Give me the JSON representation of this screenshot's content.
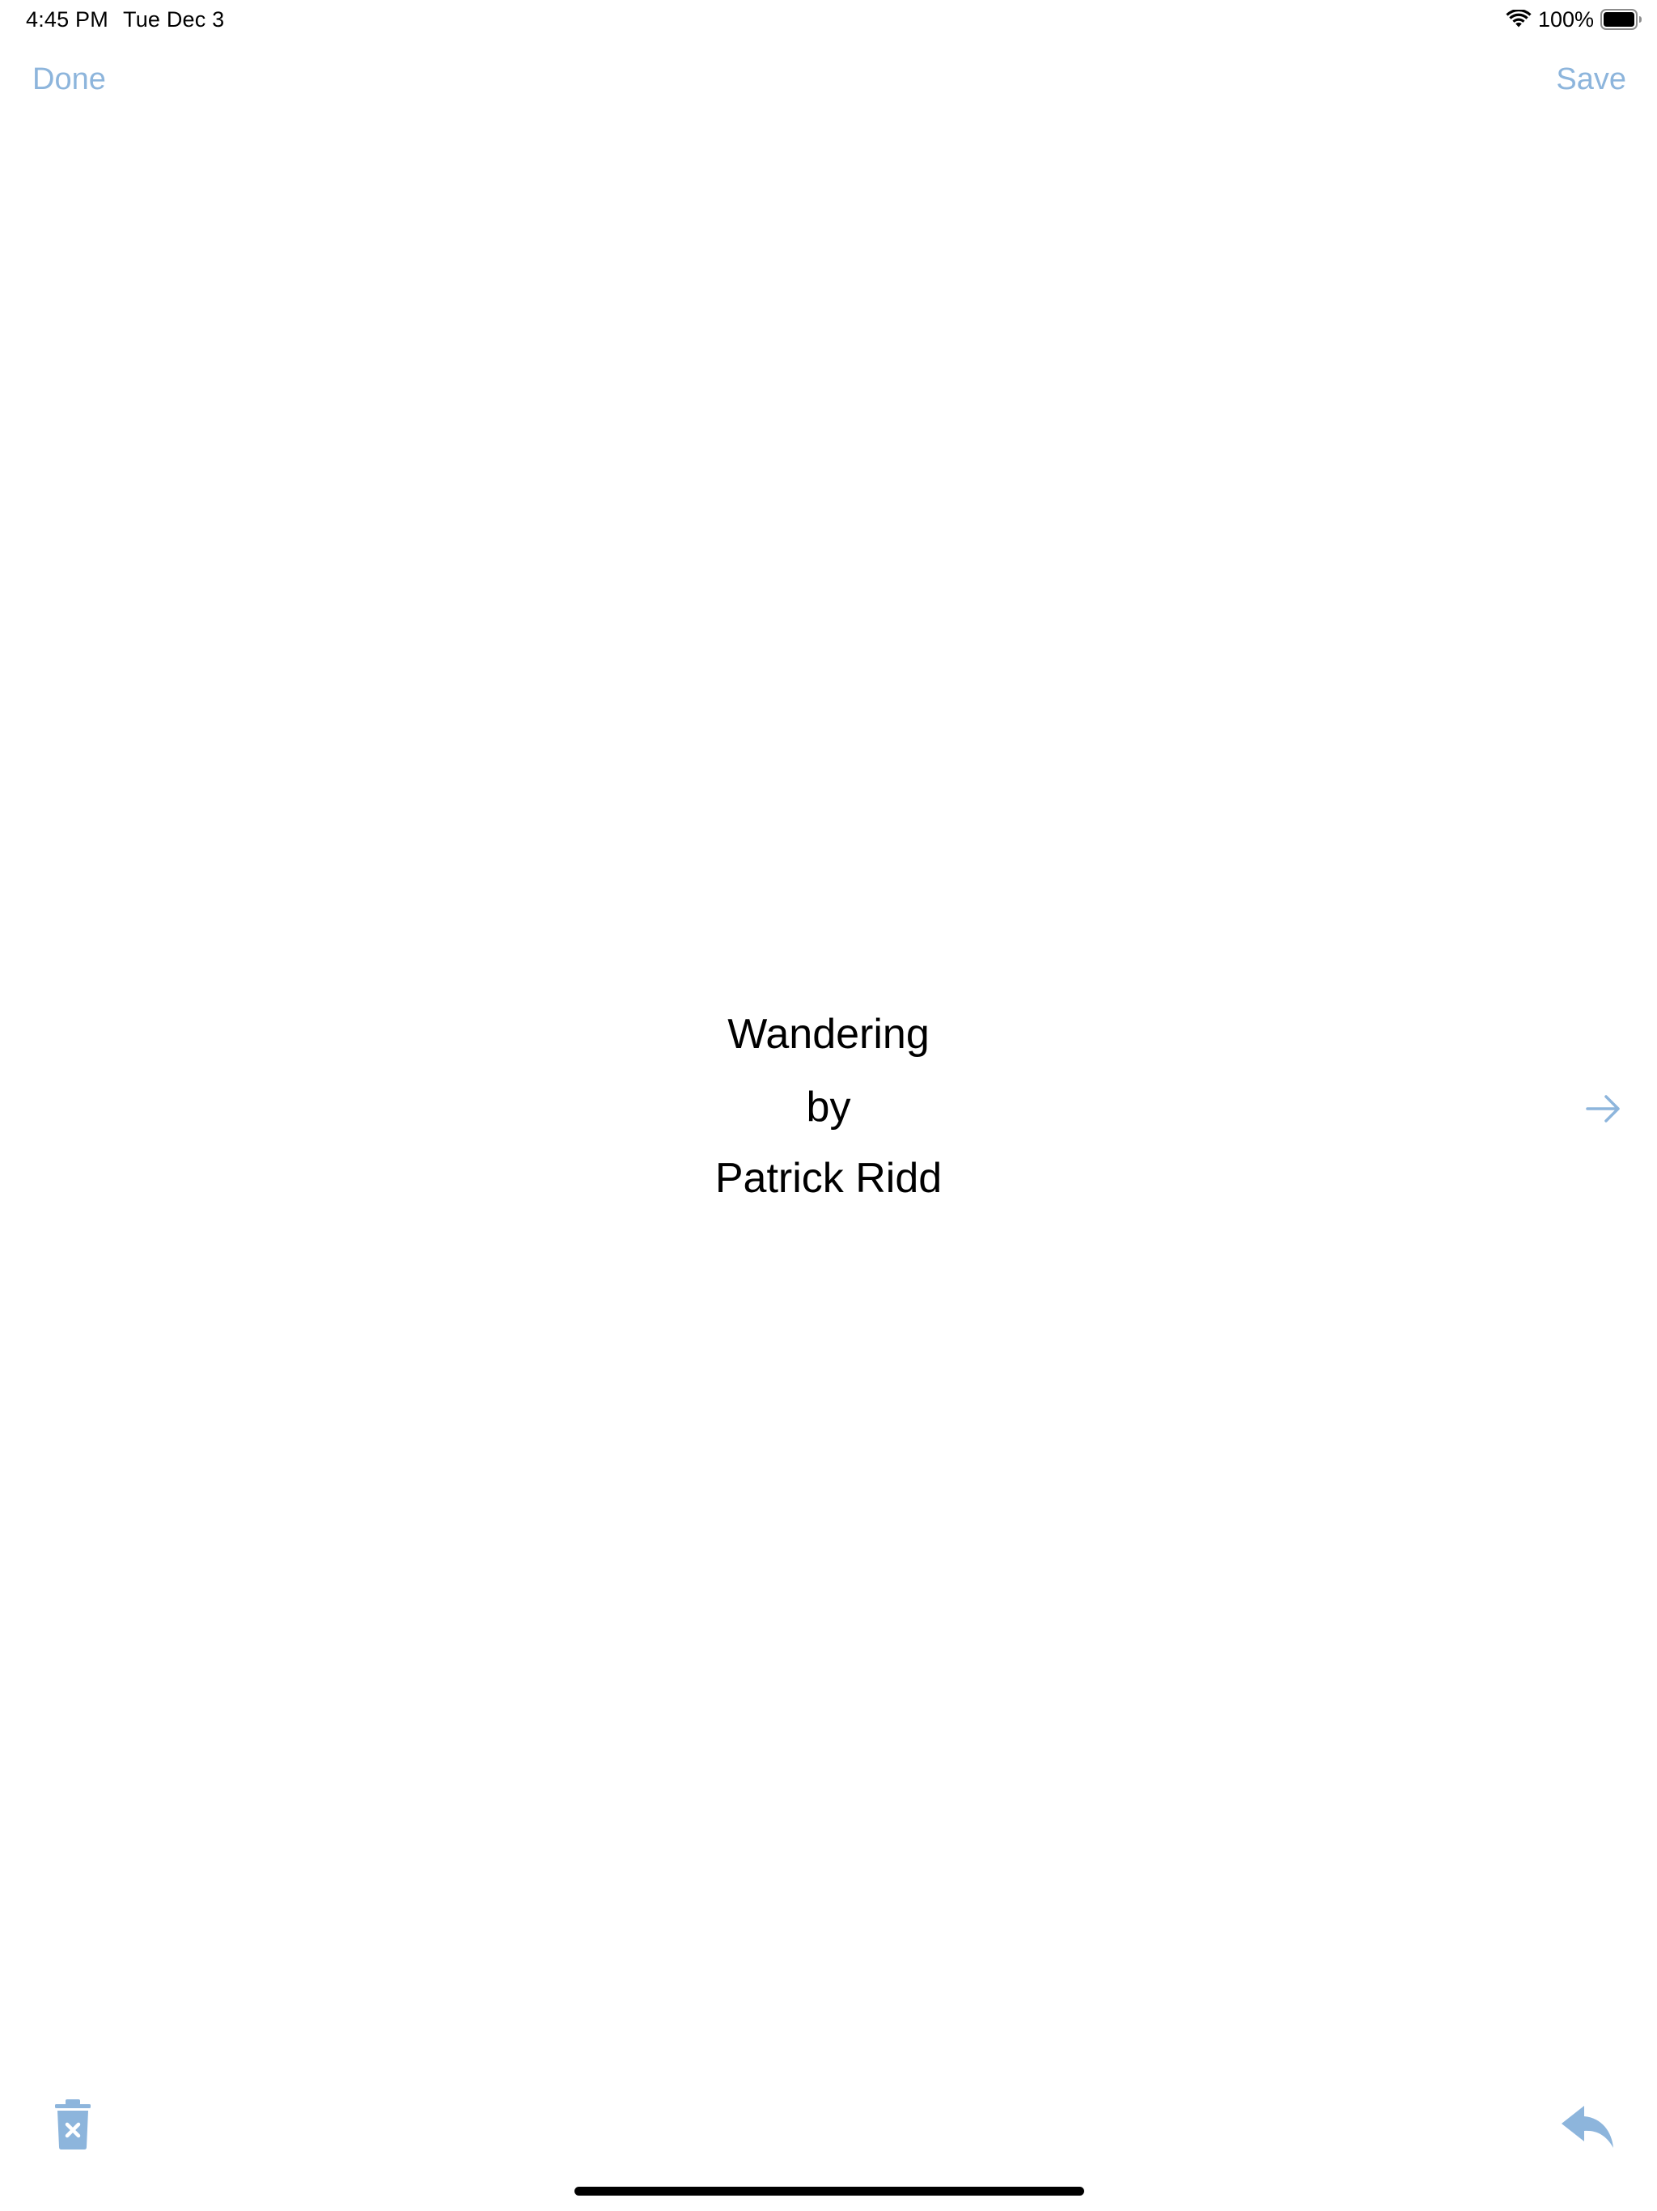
{
  "status_bar": {
    "time": "4:45 PM",
    "date": "Tue Dec 3",
    "battery_percent": "100%",
    "battery_level": 1.0,
    "wifi_icon": "wifi-icon",
    "battery_icon": "battery-icon"
  },
  "nav": {
    "done_label": "Done",
    "save_label": "Save"
  },
  "page": {
    "title": "Wandering",
    "by": "by",
    "author": "Patrick Ridd"
  },
  "icons": {
    "next": "arrow-right-icon",
    "trash": "trash-icon",
    "reply": "reply-icon"
  },
  "colors": {
    "accent": "#8db5dc",
    "text": "#000000",
    "background": "#ffffff"
  }
}
